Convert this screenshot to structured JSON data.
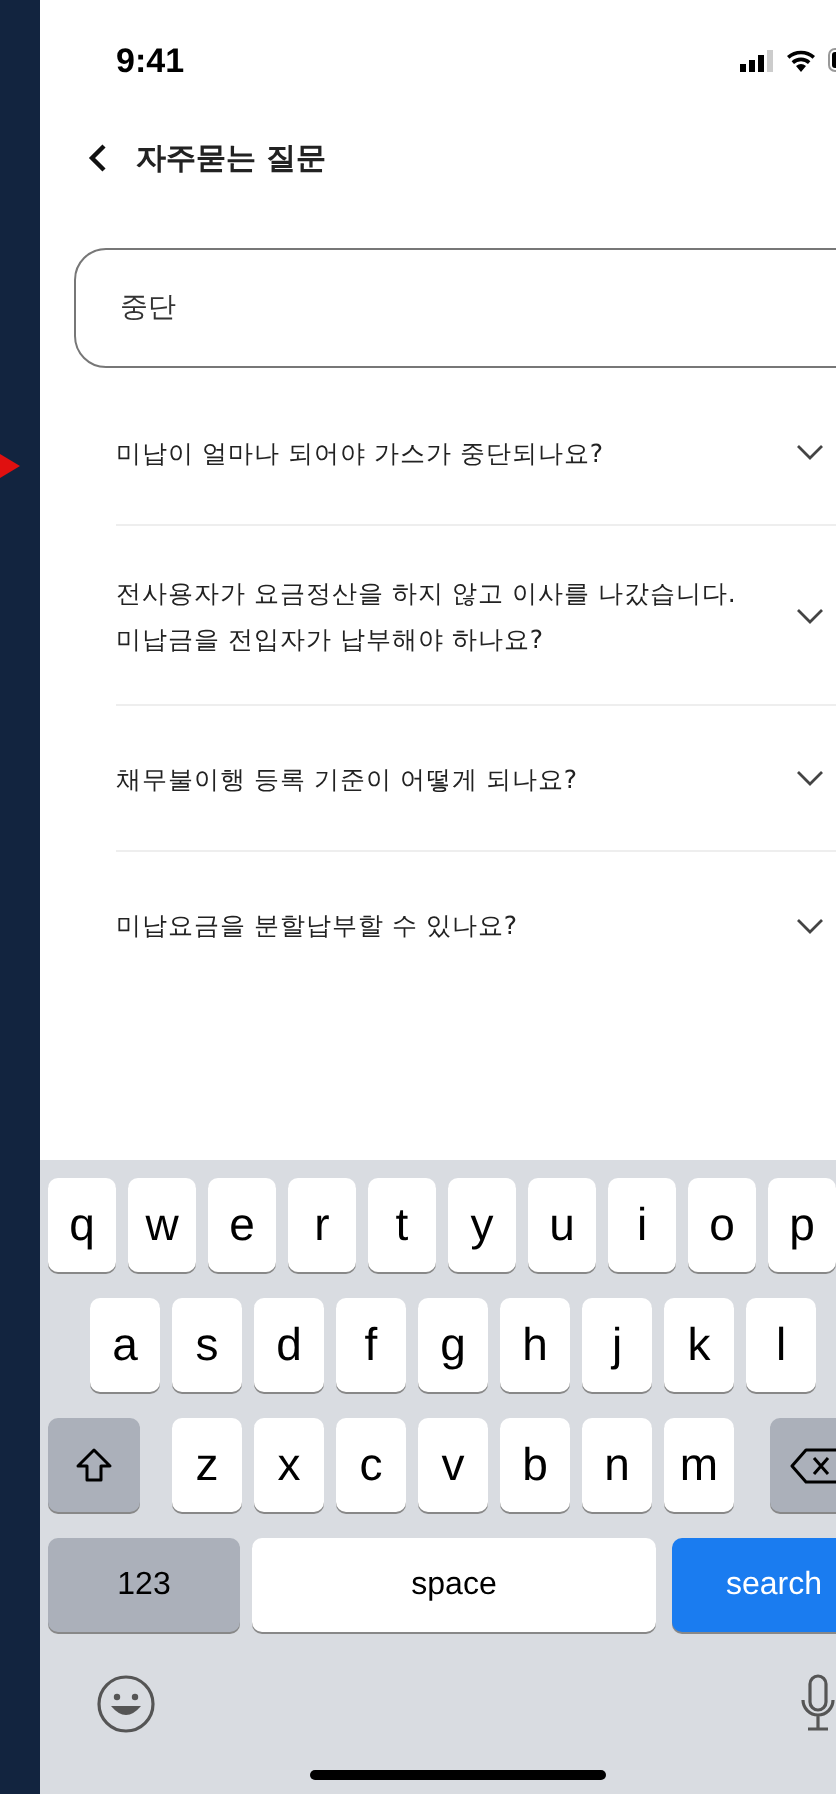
{
  "status_bar": {
    "time": "9:41"
  },
  "header": {
    "title": "자주묻는 질문"
  },
  "search": {
    "value": "중단"
  },
  "faqs": [
    {
      "lines": [
        "미납이 얼마나 되어야 가스가 중단되나요?"
      ],
      "expanded": false
    },
    {
      "lines": [
        "전사용자가 요금정산을 하지 않고 이사를 나갔습니다.",
        "미납금을 전입자가 납부해야 하나요?"
      ],
      "expanded": false
    },
    {
      "lines": [
        "채무불이행 등록 기준이 어떻게 되나요?"
      ],
      "expanded": false
    },
    {
      "lines": [
        "미납요금을 분할납부할 수 있나요?"
      ],
      "expanded": false
    }
  ],
  "keyboard": {
    "rows": [
      [
        "q",
        "w",
        "e",
        "r",
        "t",
        "y",
        "u",
        "i",
        "o",
        "p"
      ],
      [
        "a",
        "s",
        "d",
        "f",
        "g",
        "h",
        "j",
        "k",
        "l"
      ],
      [
        "z",
        "x",
        "c",
        "v",
        "b",
        "n",
        "m"
      ]
    ],
    "numbers_key": "123",
    "space_key": "space",
    "action_key": "search"
  }
}
